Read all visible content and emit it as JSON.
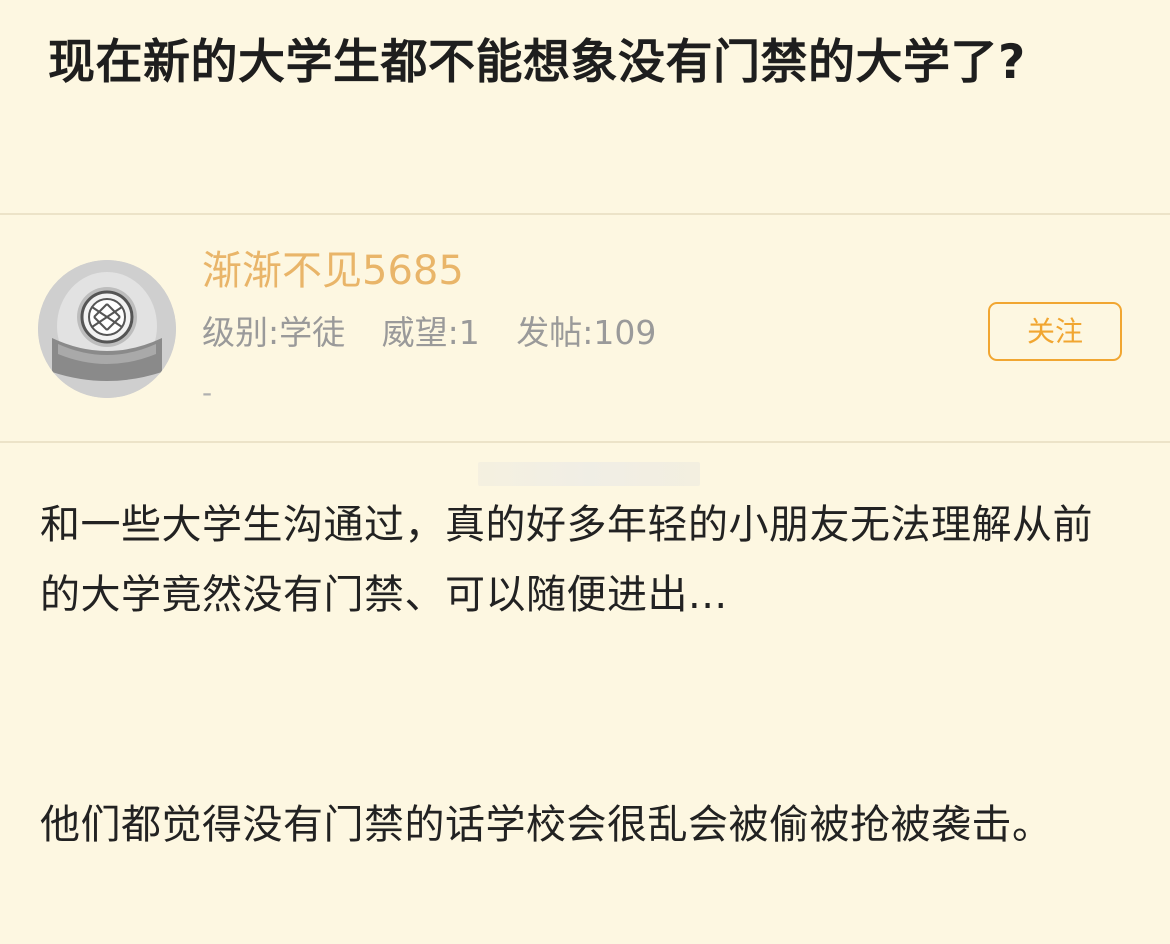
{
  "post": {
    "title": "现在新的大学生都不能想象没有门禁的大学了?"
  },
  "author": {
    "name": "渐渐不见5685",
    "level": "级别:学徒",
    "prestige": "威望:1",
    "posts": "发帖:109",
    "extra": "-",
    "follow_label": "关注",
    "avatar_icon": "diving-helmet-icon"
  },
  "content": {
    "paragraphs": [
      "和一些大学生沟通过，真的好多年轻的小朋友无法理解从前的大学竟然没有门禁、可以随便进出...",
      "他们都觉得没有门禁的话学校会很乱会被偷被抢被袭击。"
    ]
  },
  "colors": {
    "background": "#fdf7e1",
    "author_name": "#e9b569",
    "accent": "#f1a631",
    "muted_text": "#9a9a9a"
  }
}
